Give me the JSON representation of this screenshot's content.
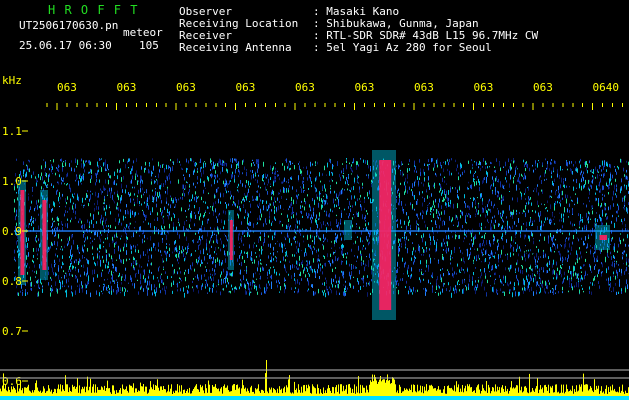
{
  "header": {
    "brand": "H R O F F T",
    "filename": "UT2506170630.pn",
    "tag": "meteor",
    "datetime": "25.06.17 06:30",
    "count": "105",
    "info_labels": [
      "Observer",
      "Receiving Location",
      "Receiver",
      "Receiving Antenna"
    ],
    "info_values": [
      ": Masaki Kano",
      ": Shibukawa, Gunma, Japan",
      ": RTL-SDR SDR# 43dB L15 96.7MHz CW",
      ": 5el Yagi Az 280 for Seoul"
    ]
  },
  "axis": {
    "unit": "kHz",
    "y_ticks": [
      "1.1",
      "1.0",
      "0.9",
      "0.8",
      "0.7",
      "0.6"
    ],
    "y_values": [
      1.1,
      1.0,
      0.9,
      0.8,
      0.7,
      0.6
    ],
    "time_ticks": [
      "063",
      "063",
      "063",
      "063",
      "063",
      "063",
      "063",
      "063",
      "063",
      "0640"
    ]
  },
  "colors": {
    "brand": "#22dd22",
    "info_text": "#ffffff",
    "axis_text": "#ffff00",
    "background": "#000000",
    "tick_marks": "#ffff00",
    "signal_low": "#1030a0",
    "signal_mid": "#00c0e0",
    "signal_high": "#ff2060",
    "level_bars": "#ffff00",
    "level_base": "#00e0ff"
  }
}
